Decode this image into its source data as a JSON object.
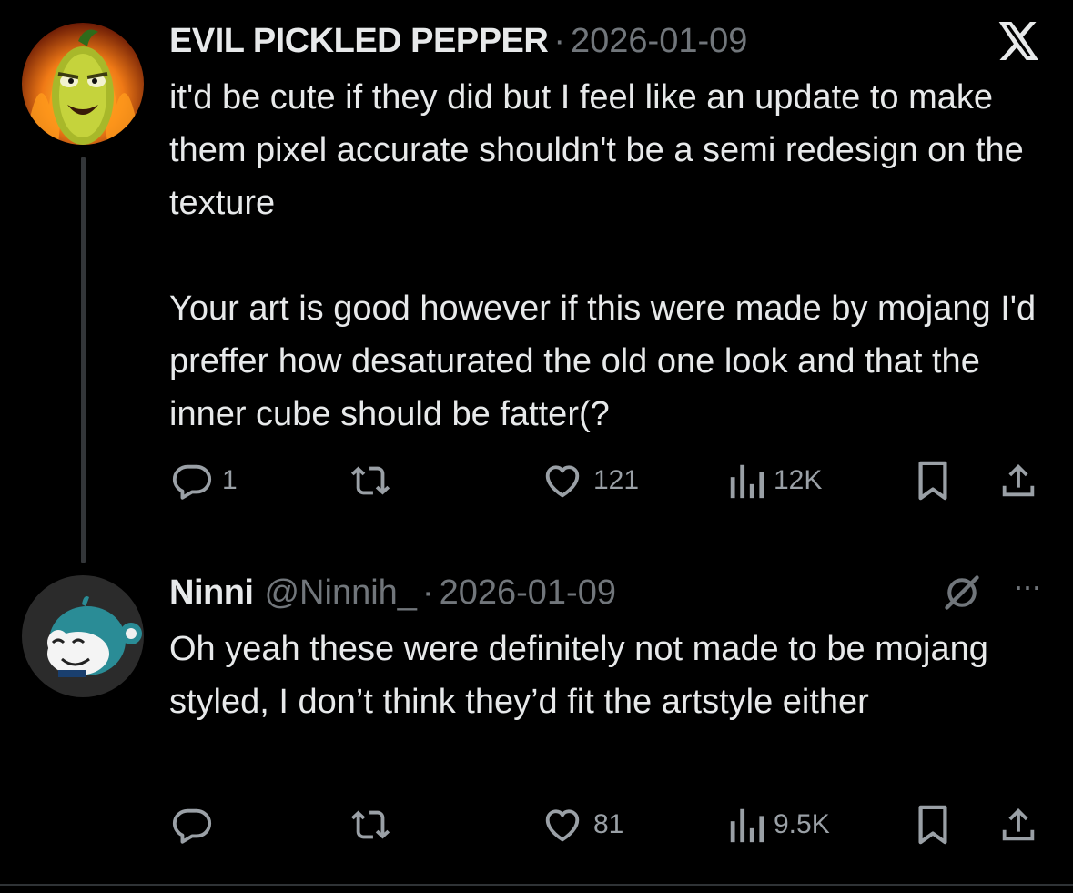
{
  "tweets": [
    {
      "display_name": "EVIL PICKLED PEPPER",
      "handle": "",
      "separator": "·",
      "date": "2026-01-09",
      "top_right_icon": "x-logo-icon",
      "paragraphs": [
        "it'd be cute if they did but I feel like an update to make them pixel accurate shouldn't be a semi redesign on the texture",
        "Your art is good however if this were made by mojang I'd preffer how desaturated the old one look and that the inner cube should be fatter(?"
      ],
      "metrics": {
        "replies": "1",
        "reposts": "",
        "likes": "121",
        "views": "12K"
      }
    },
    {
      "display_name": "Ninni",
      "handle": "@Ninnih_",
      "separator": "·",
      "date": "2026-01-09",
      "top_right_icon": "grok-icon",
      "more_label": "···",
      "paragraphs": [
        "Oh yeah these were definitely not made to be mojang styled, I don’t think they’d fit the artstyle either"
      ],
      "metrics": {
        "replies": "",
        "reposts": "",
        "likes": "81",
        "views": "9.5K"
      }
    }
  ],
  "icons": {
    "reply": "reply-icon",
    "repost": "repost-icon",
    "like": "heart-icon",
    "views": "views-icon",
    "bookmark": "bookmark-icon",
    "share": "share-icon"
  },
  "colors": {
    "background": "#000000",
    "text": "#e7e9ea",
    "secondary": "#71767b",
    "thread_line": "#333639"
  }
}
